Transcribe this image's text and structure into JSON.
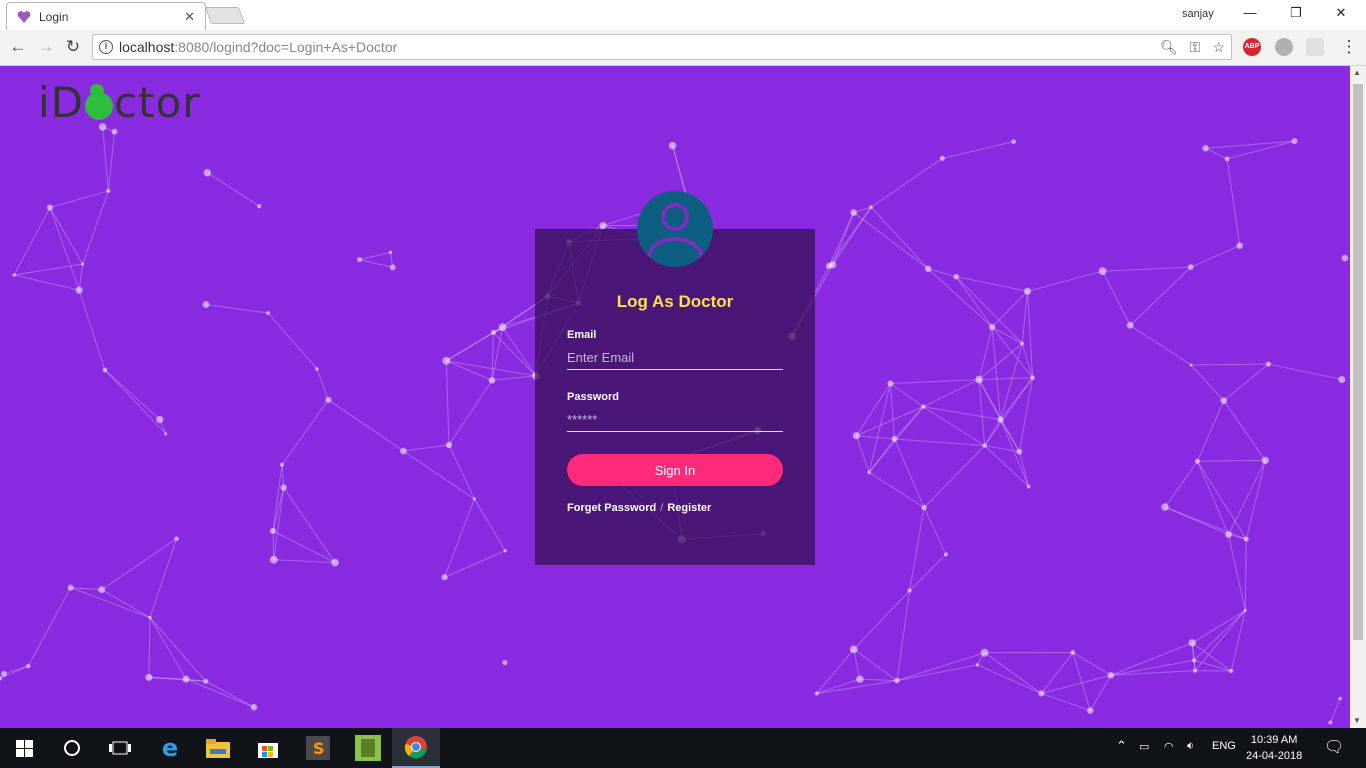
{
  "browser": {
    "tab_title": "Login",
    "user_name": "sanjay",
    "url_host": "localhost",
    "url_rest": ":8080/logind?doc=Login+As+Doctor",
    "ext_abp": "ABP"
  },
  "page": {
    "logo_prefix": "iD",
    "logo_suffix": "ctor",
    "title": "Log As Doctor",
    "email_label": "Email",
    "email_placeholder": "Enter Email",
    "password_label": "Password",
    "password_placeholder": "******",
    "signin_label": "Sign In",
    "forget_label": "Forget Password",
    "separator": "/",
    "register_label": "Register",
    "colors": {
      "background": "#8a2be2",
      "accent": "#ff2a7a",
      "title": "#ffe14d",
      "avatar": "#0e5e82"
    }
  },
  "taskbar": {
    "language": "ENG",
    "time": "10:39 AM",
    "date": "24-04-2018"
  }
}
